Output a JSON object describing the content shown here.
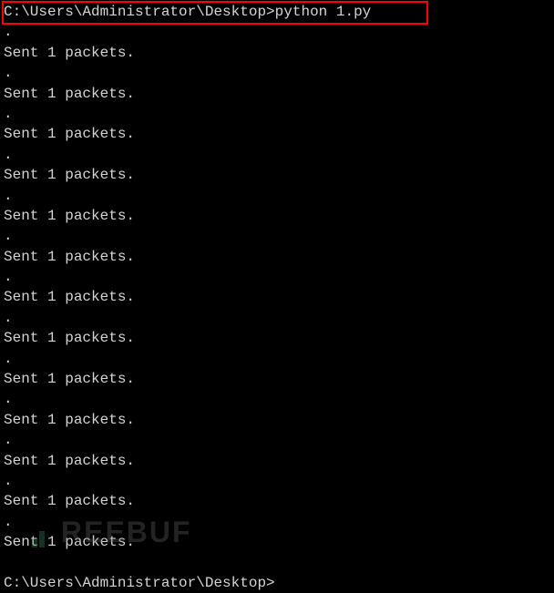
{
  "prompt1": {
    "path": "C:\\Users\\Administrator\\Desktop>",
    "command": "python 1.py"
  },
  "outputs": [
    "Sent 1 packets.",
    "Sent 1 packets.",
    "Sent 1 packets.",
    "Sent 1 packets.",
    "Sent 1 packets.",
    "Sent 1 packets.",
    "Sent 1 packets.",
    "Sent 1 packets.",
    "Sent 1 packets.",
    "Sent 1 packets.",
    "Sent 1 packets.",
    "Sent 1 packets.",
    "Sent 1 packets."
  ],
  "dot": ".",
  "prompt2": {
    "path": "C:\\Users\\Administrator\\Desktop>",
    "command": ""
  },
  "watermark_text": "REEBUF",
  "highlight_color": "#ff0000"
}
